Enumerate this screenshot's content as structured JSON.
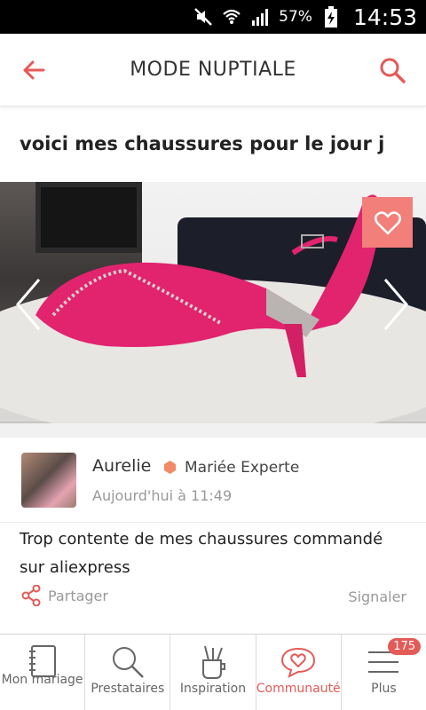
{
  "status_bar": {
    "battery_percent": "57%",
    "time": "14:53",
    "icons": [
      "mute-icon",
      "wifi-icon",
      "signal-icon",
      "battery-charging-icon"
    ]
  },
  "header": {
    "title": "MODE NUPTIALE",
    "back_icon": "arrow-left-icon",
    "search_icon": "search-icon"
  },
  "post": {
    "title": "voici mes chaussures pour le jour j",
    "photo_alt": "pink sandal shoe",
    "author": {
      "name": "Aurelie",
      "badge": "Mariée Experte",
      "timestamp": "Aujourd'hui à 11:49"
    },
    "body": "Trop contente de mes chaussures commandé sur aliexpress",
    "share_label": "Partager",
    "report_label": "Signaler"
  },
  "bottom_nav": {
    "items": [
      {
        "label": "Mon mariage",
        "icon": "notebook-icon"
      },
      {
        "label": "Prestataires",
        "icon": "search-icon"
      },
      {
        "label": "Inspiration",
        "icon": "brushes-icon"
      },
      {
        "label": "Communauté",
        "icon": "chat-heart-icon",
        "active": true
      },
      {
        "label": "Plus",
        "icon": "menu-icon",
        "badge": "175"
      }
    ]
  },
  "colors": {
    "accent": "#e45a57",
    "fav_button": "#f37f7a",
    "shoe_pink": "#e2236e"
  }
}
